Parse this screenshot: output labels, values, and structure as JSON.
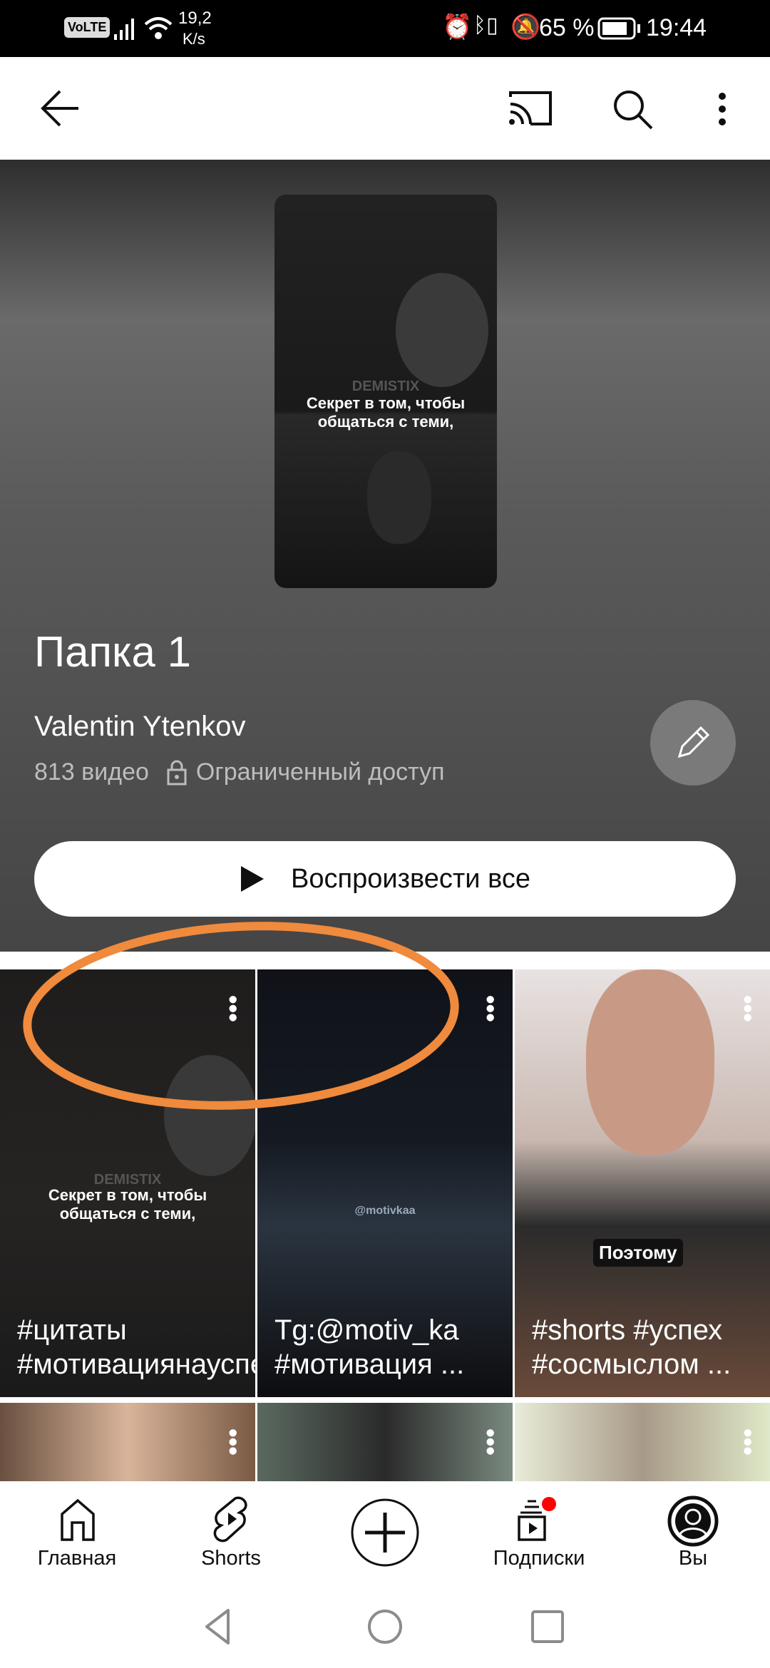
{
  "status_bar": {
    "network": "VoLTE",
    "speed_value": "19,2",
    "speed_unit": "K/s",
    "battery": "65 %",
    "time": "19:44"
  },
  "app_bar": {
    "back": "arrow-back-icon",
    "cast": "cast-icon",
    "search": "search-icon",
    "more": "more-vert-icon"
  },
  "playlist": {
    "thumbnail_overlay_brand": "DEMISTIX",
    "thumbnail_caption": "Секрет в том, чтобы общаться с теми,",
    "title": "Папка 1",
    "channel": "Valentin Ytenkov",
    "video_count": "813 видео",
    "privacy": "Ограниченный доступ",
    "play_all_label": "Воспроизвести все"
  },
  "annotation": {
    "color": "#f08a3c"
  },
  "videos": [
    {
      "title": "#цитаты #мотивациянауспе...",
      "overlay_brand": "DEMISTIX",
      "overlay_caption": "Секрет в том, чтобы общаться с теми,"
    },
    {
      "title": "Tg:@motiv_ka #мотивация ...",
      "overlay_caption": "@motivkaa"
    },
    {
      "title": "#shorts #успех #сосмыслом ...",
      "overlay_caption": "Поэтому"
    },
    {
      "title": ""
    },
    {
      "title": ""
    },
    {
      "title": ""
    }
  ],
  "bottom_nav": [
    {
      "label": "Главная",
      "icon": "home-icon"
    },
    {
      "label": "Shorts",
      "icon": "shorts-icon"
    },
    {
      "label": "",
      "icon": "create-plus-icon"
    },
    {
      "label": "Подписки",
      "icon": "subscriptions-icon"
    },
    {
      "label": "Вы",
      "icon": "account-icon"
    }
  ]
}
